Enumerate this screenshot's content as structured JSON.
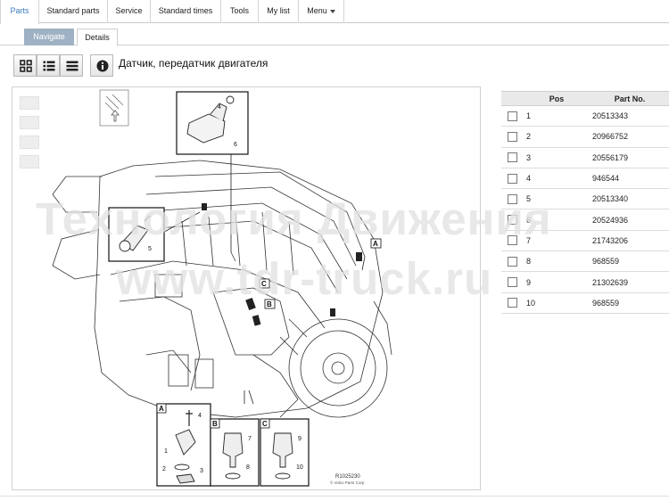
{
  "menu": {
    "items": [
      {
        "label": "Parts",
        "active": true
      },
      {
        "label": "Standard parts"
      },
      {
        "label": "Service"
      },
      {
        "label": "Standard times"
      },
      {
        "label": "Tools"
      },
      {
        "label": "My list"
      },
      {
        "label": "Menu"
      }
    ]
  },
  "subtabs": {
    "navigate": "Navigate",
    "details": "Details"
  },
  "toolbar": {
    "icons": [
      "grid-view-icon",
      "list-view-icon",
      "detail-list-icon",
      "info-icon"
    ]
  },
  "page_title": "Датчик, передатчик двигателя",
  "drawing": {
    "reference": "R1025230",
    "copyright": "© Volvo Parts Corp",
    "callouts": [
      "1",
      "2",
      "3",
      "4",
      "5",
      "6",
      "7",
      "8",
      "9",
      "10"
    ],
    "detail_labels": [
      "A",
      "B",
      "C"
    ]
  },
  "parts_table": {
    "headers": {
      "pos": "Pos",
      "part_no": "Part No."
    },
    "rows": [
      {
        "pos": "1",
        "part_no": "20513343"
      },
      {
        "pos": "2",
        "part_no": "20966752"
      },
      {
        "pos": "3",
        "part_no": "20556179"
      },
      {
        "pos": "4",
        "part_no": "946544"
      },
      {
        "pos": "5",
        "part_no": "20513340"
      },
      {
        "pos": "6",
        "part_no": "20524936"
      },
      {
        "pos": "7",
        "part_no": "21743206"
      },
      {
        "pos": "8",
        "part_no": "968559"
      },
      {
        "pos": "9",
        "part_no": "21302639"
      },
      {
        "pos": "10",
        "part_no": "968559"
      }
    ]
  },
  "watermark": {
    "line1": "Технология Движения",
    "line2": "www.tdr-truck.ru"
  }
}
